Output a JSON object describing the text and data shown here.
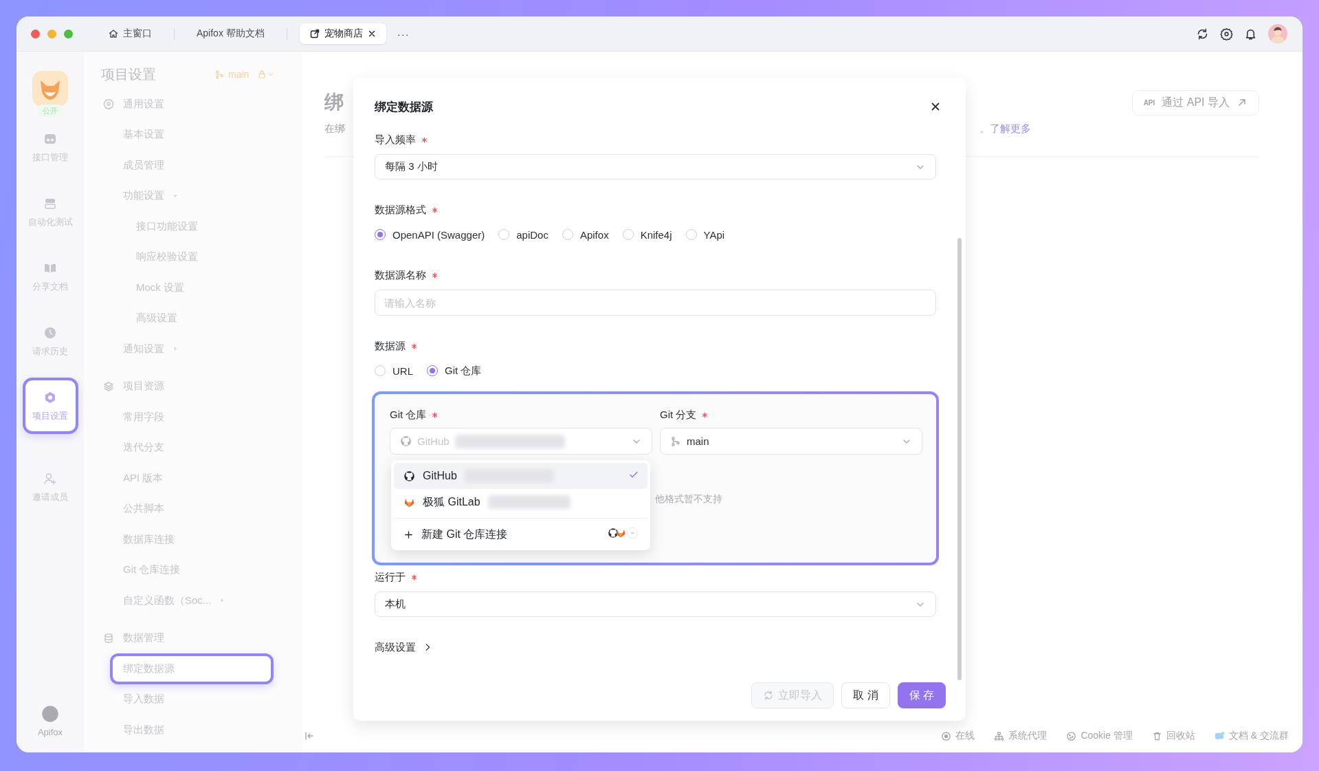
{
  "titlebar": {
    "tabs": [
      {
        "label": "主窗口",
        "kind": "home",
        "selected": false
      },
      {
        "label": "Apifox 帮助文档",
        "kind": "docs",
        "selected": false
      },
      {
        "label": "宠物商店",
        "kind": "project",
        "selected": true
      }
    ],
    "more": "···"
  },
  "rail": {
    "badge": "公开",
    "items": [
      {
        "label": "接口管理",
        "kind": "api",
        "selected": false
      },
      {
        "label": "自动化测试",
        "kind": "automation",
        "selected": false
      },
      {
        "label": "分享文档",
        "kind": "share",
        "selected": false
      },
      {
        "label": "请求历史",
        "kind": "history",
        "selected": false
      },
      {
        "label": "项目设置",
        "kind": "settings",
        "selected": true
      },
      {
        "label": "邀请成员",
        "kind": "invite",
        "selected": false
      }
    ],
    "brand": "Apifox"
  },
  "sidebar": {
    "title": "项目设置",
    "branch": "main",
    "groups": [
      {
        "label": "通用设置",
        "kind": "general",
        "children": [
          {
            "label": "基本设置",
            "selected": false
          },
          {
            "label": "成员管理",
            "selected": false
          },
          {
            "label": "功能设置",
            "selected": false,
            "expanded": true,
            "children": [
              {
                "label": "接口功能设置",
                "selected": false
              },
              {
                "label": "响应校验设置",
                "selected": false
              },
              {
                "label": "Mock 设置",
                "selected": false
              },
              {
                "label": "高级设置",
                "selected": false
              }
            ]
          },
          {
            "label": "通知设置",
            "selected": false,
            "expanded": false
          }
        ]
      },
      {
        "label": "项目资源",
        "kind": "resources",
        "children": [
          {
            "label": "常用字段",
            "selected": false
          },
          {
            "label": "迭代分支",
            "selected": false
          },
          {
            "label": "API 版本",
            "selected": false
          },
          {
            "label": "公共脚本",
            "selected": false
          },
          {
            "label": "数据库连接",
            "selected": false
          },
          {
            "label": "Git 仓库连接",
            "selected": false
          },
          {
            "label": "自定义函数（Soc...",
            "selected": false,
            "expanded": false
          }
        ]
      },
      {
        "label": "数据管理",
        "kind": "data",
        "children": [
          {
            "label": "绑定数据源",
            "selected": true
          },
          {
            "label": "导入数据",
            "selected": false
          },
          {
            "label": "导出数据",
            "selected": false
          }
        ]
      }
    ]
  },
  "main": {
    "title": "绑",
    "subtitle": "在绑",
    "subtitle_end": "。",
    "learn_more": "了解更多",
    "api_badge": "API",
    "api_import": "通过 API 导入"
  },
  "status_bar": {
    "items": [
      {
        "label": "在线",
        "kind": "online"
      },
      {
        "label": "系统代理",
        "kind": "proxy"
      },
      {
        "label": "Cookie 管理",
        "kind": "cookie"
      },
      {
        "label": "回收站",
        "kind": "trash"
      },
      {
        "label": "文档 & 交流群",
        "kind": "community"
      }
    ]
  },
  "dialog": {
    "title": "绑定数据源",
    "fields": [
      {
        "kind": "select",
        "label": "导入频率",
        "required": true,
        "value": "每隔 3 小时"
      },
      {
        "kind": "radio",
        "label": "数据源格式",
        "required": true,
        "options": [
          {
            "label": "OpenAPI (Swagger)",
            "selected": true
          },
          {
            "label": "apiDoc",
            "selected": false
          },
          {
            "label": "Apifox",
            "selected": false
          },
          {
            "label": "Knife4j",
            "selected": false
          },
          {
            "label": "YApi",
            "selected": false
          }
        ]
      },
      {
        "kind": "input",
        "label": "数据源名称",
        "required": true,
        "placeholder": "请输入名称"
      },
      {
        "kind": "radio",
        "label": "数据源",
        "required": true,
        "options": [
          {
            "label": "URL",
            "selected": false
          },
          {
            "label": "Git 仓库",
            "selected": true
          }
        ]
      },
      {
        "kind": "git",
        "repo": {
          "label": "Git 仓库",
          "required": true,
          "value": "GitHub"
        },
        "branch": {
          "label": "Git 分支",
          "required": true,
          "value": "main"
        },
        "hint": "他格式暂不支持",
        "menu": {
          "items": [
            {
              "label": "GitHub",
              "kind": "github",
              "selected": true
            },
            {
              "label": "极狐 GitLab",
              "kind": "gitlab",
              "selected": false
            }
          ],
          "create": "新建 Git 仓库连接"
        }
      },
      {
        "kind": "select",
        "label": "运行于",
        "required": true,
        "value": "本机"
      },
      {
        "kind": "link",
        "label": "高级设置"
      }
    ],
    "buttons": [
      {
        "label": "立即导入",
        "kind": "sync",
        "disabled": true
      },
      {
        "label": "取 消",
        "kind": "default",
        "disabled": false
      },
      {
        "label": "保 存",
        "kind": "primary",
        "disabled": false
      }
    ]
  }
}
